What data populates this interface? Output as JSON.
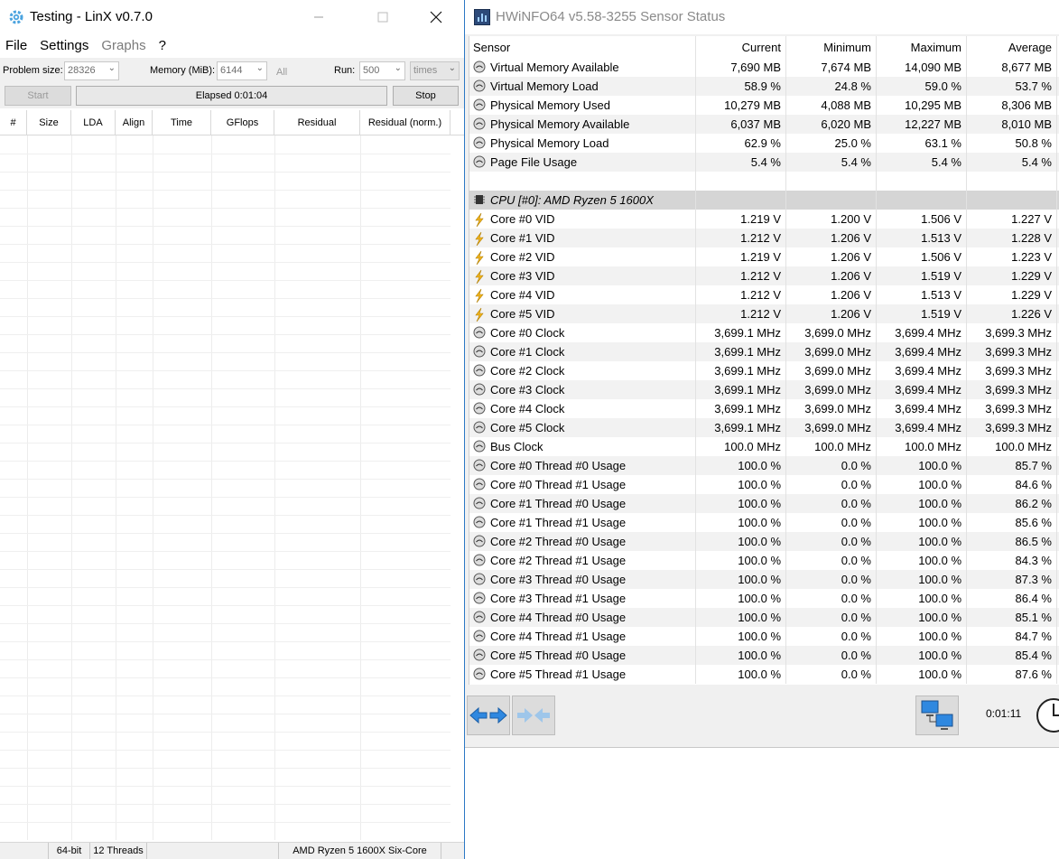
{
  "linx": {
    "title": "Testing - LinX v0.7.0",
    "menu": [
      "File",
      "Settings",
      "Graphs",
      "?"
    ],
    "problem_size_label": "Problem size:",
    "problem_size_value": "28326",
    "memory_label": "Memory (MiB):",
    "memory_value": "6144",
    "all_label": "All",
    "run_label": "Run:",
    "run_value": "500",
    "run_unit": "times",
    "start_label": "Start",
    "elapsed_label": "Elapsed 0:01:04",
    "stop_label": "Stop",
    "columns": [
      "#",
      "Size",
      "LDA",
      "Align",
      "Time",
      "GFlops",
      "Residual",
      "Residual (norm.)"
    ],
    "status": [
      "",
      "64-bit",
      "12 Threads",
      "",
      "AMD Ryzen 5 1600X Six-Core"
    ]
  },
  "hwinfo": {
    "title": "HWiNFO64 v5.58-3255 Sensor Status",
    "columns": [
      "Sensor",
      "Current",
      "Minimum",
      "Maximum",
      "Average"
    ],
    "elapsed": "0:01:11",
    "rows": [
      {
        "type": "sensor",
        "icon": "gauge-icon",
        "name": "Virtual Memory Available",
        "values": [
          "7,690 MB",
          "7,674 MB",
          "14,090 MB",
          "8,677 MB"
        ]
      },
      {
        "type": "sensor",
        "icon": "gauge-icon",
        "name": "Virtual Memory Load",
        "values": [
          "58.9 %",
          "24.8 %",
          "59.0 %",
          "53.7 %"
        ]
      },
      {
        "type": "sensor",
        "icon": "gauge-icon",
        "name": "Physical Memory Used",
        "values": [
          "10,279 MB",
          "4,088 MB",
          "10,295 MB",
          "8,306 MB"
        ]
      },
      {
        "type": "sensor",
        "icon": "gauge-icon",
        "name": "Physical Memory Available",
        "values": [
          "6,037 MB",
          "6,020 MB",
          "12,227 MB",
          "8,010 MB"
        ]
      },
      {
        "type": "sensor",
        "icon": "gauge-icon",
        "name": "Physical Memory Load",
        "values": [
          "62.9 %",
          "25.0 %",
          "63.1 %",
          "50.8 %"
        ]
      },
      {
        "type": "sensor",
        "icon": "gauge-icon",
        "name": "Page File Usage",
        "values": [
          "5.4 %",
          "5.4 %",
          "5.4 %",
          "5.4 %"
        ]
      },
      {
        "type": "blank"
      },
      {
        "type": "group",
        "icon": "cpu-chip-icon",
        "name": "CPU [#0]: AMD Ryzen 5 1600X"
      },
      {
        "type": "sensor",
        "icon": "voltage-icon",
        "name": "Core #0 VID",
        "values": [
          "1.219 V",
          "1.200 V",
          "1.506 V",
          "1.227 V"
        ]
      },
      {
        "type": "sensor",
        "icon": "voltage-icon",
        "name": "Core #1 VID",
        "values": [
          "1.212 V",
          "1.206 V",
          "1.513 V",
          "1.228 V"
        ]
      },
      {
        "type": "sensor",
        "icon": "voltage-icon",
        "name": "Core #2 VID",
        "values": [
          "1.219 V",
          "1.206 V",
          "1.506 V",
          "1.223 V"
        ]
      },
      {
        "type": "sensor",
        "icon": "voltage-icon",
        "name": "Core #3 VID",
        "values": [
          "1.212 V",
          "1.206 V",
          "1.519 V",
          "1.229 V"
        ]
      },
      {
        "type": "sensor",
        "icon": "voltage-icon",
        "name": "Core #4 VID",
        "values": [
          "1.212 V",
          "1.206 V",
          "1.513 V",
          "1.229 V"
        ]
      },
      {
        "type": "sensor",
        "icon": "voltage-icon",
        "name": "Core #5 VID",
        "values": [
          "1.212 V",
          "1.206 V",
          "1.519 V",
          "1.226 V"
        ]
      },
      {
        "type": "sensor",
        "icon": "gauge-icon",
        "name": "Core #0 Clock",
        "values": [
          "3,699.1 MHz",
          "3,699.0 MHz",
          "3,699.4 MHz",
          "3,699.3 MHz"
        ]
      },
      {
        "type": "sensor",
        "icon": "gauge-icon",
        "name": "Core #1 Clock",
        "values": [
          "3,699.1 MHz",
          "3,699.0 MHz",
          "3,699.4 MHz",
          "3,699.3 MHz"
        ]
      },
      {
        "type": "sensor",
        "icon": "gauge-icon",
        "name": "Core #2 Clock",
        "values": [
          "3,699.1 MHz",
          "3,699.0 MHz",
          "3,699.4 MHz",
          "3,699.3 MHz"
        ]
      },
      {
        "type": "sensor",
        "icon": "gauge-icon",
        "name": "Core #3 Clock",
        "values": [
          "3,699.1 MHz",
          "3,699.0 MHz",
          "3,699.4 MHz",
          "3,699.3 MHz"
        ]
      },
      {
        "type": "sensor",
        "icon": "gauge-icon",
        "name": "Core #4 Clock",
        "values": [
          "3,699.1 MHz",
          "3,699.0 MHz",
          "3,699.4 MHz",
          "3,699.3 MHz"
        ]
      },
      {
        "type": "sensor",
        "icon": "gauge-icon",
        "name": "Core #5 Clock",
        "values": [
          "3,699.1 MHz",
          "3,699.0 MHz",
          "3,699.4 MHz",
          "3,699.3 MHz"
        ]
      },
      {
        "type": "sensor",
        "icon": "gauge-icon",
        "name": "Bus Clock",
        "values": [
          "100.0 MHz",
          "100.0 MHz",
          "100.0 MHz",
          "100.0 MHz"
        ]
      },
      {
        "type": "sensor",
        "icon": "gauge-icon",
        "name": "Core #0 Thread #0 Usage",
        "values": [
          "100.0 %",
          "0.0 %",
          "100.0 %",
          "85.7 %"
        ]
      },
      {
        "type": "sensor",
        "icon": "gauge-icon",
        "name": "Core #0 Thread #1 Usage",
        "values": [
          "100.0 %",
          "0.0 %",
          "100.0 %",
          "84.6 %"
        ]
      },
      {
        "type": "sensor",
        "icon": "gauge-icon",
        "name": "Core #1 Thread #0 Usage",
        "values": [
          "100.0 %",
          "0.0 %",
          "100.0 %",
          "86.2 %"
        ]
      },
      {
        "type": "sensor",
        "icon": "gauge-icon",
        "name": "Core #1 Thread #1 Usage",
        "values": [
          "100.0 %",
          "0.0 %",
          "100.0 %",
          "85.6 %"
        ]
      },
      {
        "type": "sensor",
        "icon": "gauge-icon",
        "name": "Core #2 Thread #0 Usage",
        "values": [
          "100.0 %",
          "0.0 %",
          "100.0 %",
          "86.5 %"
        ]
      },
      {
        "type": "sensor",
        "icon": "gauge-icon",
        "name": "Core #2 Thread #1 Usage",
        "values": [
          "100.0 %",
          "0.0 %",
          "100.0 %",
          "84.3 %"
        ]
      },
      {
        "type": "sensor",
        "icon": "gauge-icon",
        "name": "Core #3 Thread #0 Usage",
        "values": [
          "100.0 %",
          "0.0 %",
          "100.0 %",
          "87.3 %"
        ]
      },
      {
        "type": "sensor",
        "icon": "gauge-icon",
        "name": "Core #3 Thread #1 Usage",
        "values": [
          "100.0 %",
          "0.0 %",
          "100.0 %",
          "86.4 %"
        ]
      },
      {
        "type": "sensor",
        "icon": "gauge-icon",
        "name": "Core #4 Thread #0 Usage",
        "values": [
          "100.0 %",
          "0.0 %",
          "100.0 %",
          "85.1 %"
        ]
      },
      {
        "type": "sensor",
        "icon": "gauge-icon",
        "name": "Core #4 Thread #1 Usage",
        "values": [
          "100.0 %",
          "0.0 %",
          "100.0 %",
          "84.7 %"
        ]
      },
      {
        "type": "sensor",
        "icon": "gauge-icon",
        "name": "Core #5 Thread #0 Usage",
        "values": [
          "100.0 %",
          "0.0 %",
          "100.0 %",
          "85.4 %"
        ]
      },
      {
        "type": "sensor",
        "icon": "gauge-icon",
        "name": "Core #5 Thread #1 Usage",
        "values": [
          "100.0 %",
          "0.0 %",
          "100.0 %",
          "87.6 %"
        ]
      }
    ]
  },
  "colors": {
    "accent_blue": "#2b78c5",
    "group_row": "#d5d5d5",
    "alt_row": "#f2f2f2",
    "voltage_yellow": "#f2b51c"
  }
}
